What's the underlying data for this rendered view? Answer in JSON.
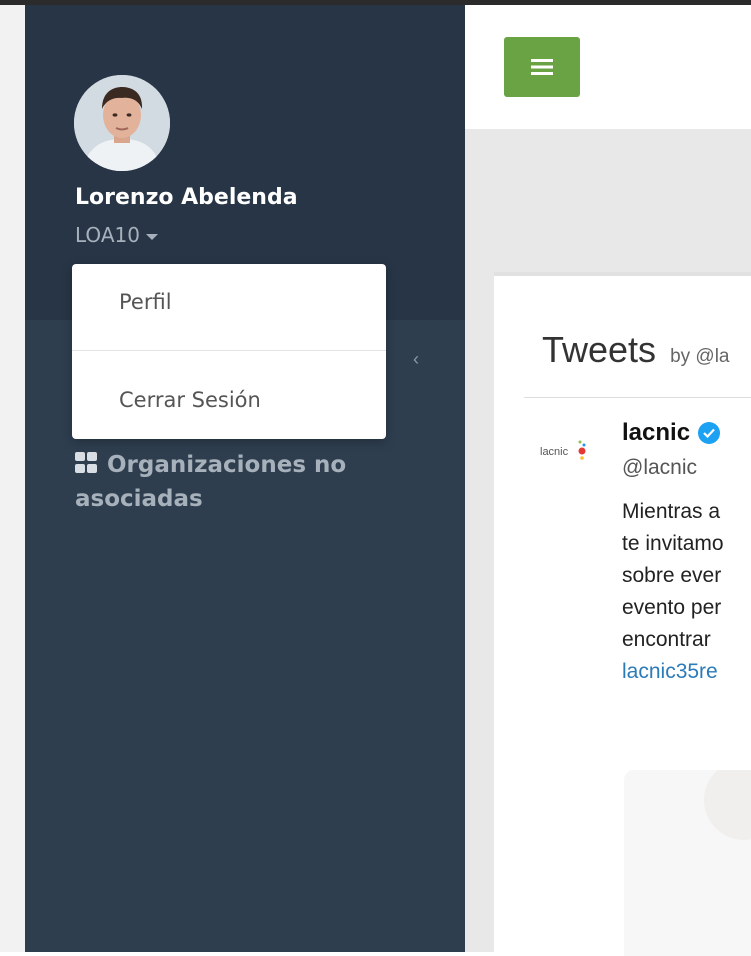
{
  "user": {
    "name": "Lorenzo Abelenda",
    "id": "LOA10"
  },
  "dropdown": {
    "items": [
      "Perfil",
      "Cerrar Sesión"
    ]
  },
  "nav": {
    "items": [
      {
        "label": "Organizaciones no asociadas",
        "icon": "grid-icon"
      }
    ]
  },
  "header": {
    "menu_icon": "hamburger-icon"
  },
  "tweets": {
    "title": "Tweets",
    "by": "by @la",
    "logo_text": "lacnic",
    "author": {
      "name": "lacnic",
      "handle": "@lacnic",
      "verified": true
    },
    "text_lines": [
      "Mientras a",
      "te invitamo",
      "sobre ever",
      "evento per",
      "encontrar "
    ],
    "link": "lacnic35re"
  },
  "colors": {
    "sidebar": "#2e3e4f",
    "sidebar_header": "#273546",
    "accent_green": "#6aa343",
    "link_blue": "#2b7bb9",
    "verified_blue": "#1da1f2"
  }
}
